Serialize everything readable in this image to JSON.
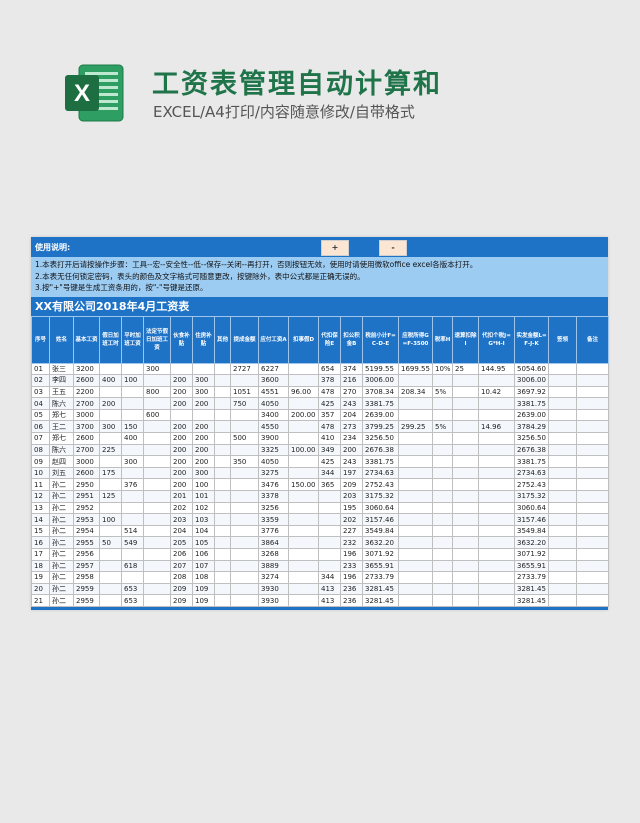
{
  "header": {
    "logo_icon": "excel-icon",
    "logo_letter": "X",
    "title": "工资表管理自动计算和",
    "subtitle": "EXCEL/A4打印/内容随意修改/自带格式"
  },
  "instructions": {
    "label": "使用说明:",
    "btn_plus": "+",
    "btn_minus": "-",
    "lines": [
      "1.本表打开后请按操作步骤：工具--宏--安全性--低--保存--关闭--再打开，否则按钮无效，使用时请使用微软office excel各版本打开。",
      "2.本表无任何锁定密码，表头的颜色及文字格式可随意更改，按键除外，表中公式都是正确无误的。",
      "3.按\"+\"号键是生成工资条用的，按\"-\"号键是还原。"
    ]
  },
  "company_title": "XX有限公司2018年4月工资表",
  "table": {
    "headers": [
      "序号",
      "姓名",
      "基本工资",
      "假日加班工时",
      "平时加班工资",
      "法定节假日加班工资",
      "伙食补贴",
      "住房补贴",
      "其他",
      "提成金额",
      "应付工资A",
      "扣事假D",
      "代扣保险E",
      "扣公积金B",
      "税前小计F=C-D-E",
      "应税所得G=F-3500",
      "税率H",
      "速算扣除I",
      "代扣个税J=G*H-I",
      "实发金额L=F-J-K",
      "签领",
      "备注"
    ],
    "rows": [
      [
        "01",
        "张三",
        "3200",
        "",
        "",
        "300",
        "",
        "",
        "",
        "2727",
        "6227",
        "",
        "654",
        "374",
        "5199.55",
        "1699.55",
        "10%",
        "25",
        "144.95",
        "5054.60",
        "",
        ""
      ],
      [
        "02",
        "李四",
        "2600",
        "400",
        "100",
        "",
        "200",
        "300",
        "",
        "",
        "3600",
        "",
        "378",
        "216",
        "3006.00",
        "",
        "",
        "",
        "",
        "3006.00",
        "",
        ""
      ],
      [
        "03",
        "王五",
        "2200",
        "",
        "",
        "800",
        "200",
        "300",
        "",
        "1051",
        "4551",
        "96.00",
        "478",
        "270",
        "3708.34",
        "208.34",
        "5%",
        "",
        "10.42",
        "3697.92",
        "",
        ""
      ],
      [
        "04",
        "陈六",
        "2700",
        "200",
        "",
        "",
        "200",
        "200",
        "",
        "750",
        "4050",
        "",
        "425",
        "243",
        "3381.75",
        "",
        "",
        "",
        "",
        "3381.75",
        "",
        ""
      ],
      [
        "05",
        "郑七",
        "3000",
        "",
        "",
        "600",
        "",
        "",
        "",
        "",
        "3400",
        "200.00",
        "357",
        "204",
        "2639.00",
        "",
        "",
        "",
        "",
        "2639.00",
        "",
        ""
      ],
      [
        "06",
        "王二",
        "3700",
        "300",
        "150",
        "",
        "200",
        "200",
        "",
        "",
        "4550",
        "",
        "478",
        "273",
        "3799.25",
        "299.25",
        "5%",
        "",
        "14.96",
        "3784.29",
        "",
        ""
      ],
      [
        "07",
        "郑七",
        "2600",
        "",
        "400",
        "",
        "200",
        "200",
        "",
        "500",
        "3900",
        "",
        "410",
        "234",
        "3256.50",
        "",
        "",
        "",
        "",
        "3256.50",
        "",
        ""
      ],
      [
        "08",
        "陈六",
        "2700",
        "225",
        "",
        "",
        "200",
        "200",
        "",
        "",
        "3325",
        "100.00",
        "349",
        "200",
        "2676.38",
        "",
        "",
        "",
        "",
        "2676.38",
        "",
        ""
      ],
      [
        "09",
        "赵四",
        "3000",
        "",
        "300",
        "",
        "200",
        "200",
        "",
        "350",
        "4050",
        "",
        "425",
        "243",
        "3381.75",
        "",
        "",
        "",
        "",
        "3381.75",
        "",
        ""
      ],
      [
        "10",
        "刘五",
        "2600",
        "175",
        "",
        "",
        "200",
        "300",
        "",
        "",
        "3275",
        "",
        "344",
        "197",
        "2734.63",
        "",
        "",
        "",
        "",
        "2734.63",
        "",
        ""
      ],
      [
        "11",
        "孙二",
        "2950",
        "",
        "376",
        "",
        "200",
        "100",
        "",
        "",
        "3476",
        "150.00",
        "365",
        "209",
        "2752.43",
        "",
        "",
        "",
        "",
        "2752.43",
        "",
        ""
      ],
      [
        "12",
        "孙二",
        "2951",
        "125",
        "",
        "",
        "201",
        "101",
        "",
        "",
        "3378",
        "",
        "",
        "203",
        "3175.32",
        "",
        "",
        "",
        "",
        "3175.32",
        "",
        ""
      ],
      [
        "13",
        "孙二",
        "2952",
        "",
        "",
        "",
        "202",
        "102",
        "",
        "",
        "3256",
        "",
        "",
        "195",
        "3060.64",
        "",
        "",
        "",
        "",
        "3060.64",
        "",
        ""
      ],
      [
        "14",
        "孙二",
        "2953",
        "100",
        "",
        "",
        "203",
        "103",
        "",
        "",
        "3359",
        "",
        "",
        "202",
        "3157.46",
        "",
        "",
        "",
        "",
        "3157.46",
        "",
        ""
      ],
      [
        "15",
        "孙二",
        "2954",
        "",
        "514",
        "",
        "204",
        "104",
        "",
        "",
        "3776",
        "",
        "",
        "227",
        "3549.84",
        "",
        "",
        "",
        "",
        "3549.84",
        "",
        ""
      ],
      [
        "16",
        "孙二",
        "2955",
        "50",
        "549",
        "",
        "205",
        "105",
        "",
        "",
        "3864",
        "",
        "",
        "232",
        "3632.20",
        "",
        "",
        "",
        "",
        "3632.20",
        "",
        ""
      ],
      [
        "17",
        "孙二",
        "2956",
        "",
        "",
        "",
        "206",
        "106",
        "",
        "",
        "3268",
        "",
        "",
        "196",
        "3071.92",
        "",
        "",
        "",
        "",
        "3071.92",
        "",
        ""
      ],
      [
        "18",
        "孙二",
        "2957",
        "",
        "618",
        "",
        "207",
        "107",
        "",
        "",
        "3889",
        "",
        "",
        "233",
        "3655.91",
        "",
        "",
        "",
        "",
        "3655.91",
        "",
        ""
      ],
      [
        "19",
        "孙二",
        "2958",
        "",
        "",
        "",
        "208",
        "108",
        "",
        "",
        "3274",
        "",
        "344",
        "196",
        "2733.79",
        "",
        "",
        "",
        "",
        "2733.79",
        "",
        ""
      ],
      [
        "20",
        "孙二",
        "2959",
        "",
        "653",
        "",
        "209",
        "109",
        "",
        "",
        "3930",
        "",
        "413",
        "236",
        "3281.45",
        "",
        "",
        "",
        "",
        "3281.45",
        "",
        ""
      ],
      [
        "21",
        "孙二",
        "2959",
        "",
        "653",
        "",
        "209",
        "109",
        "",
        "",
        "3930",
        "",
        "413",
        "236",
        "3281.45",
        "",
        "",
        "",
        "",
        "3281.45",
        "",
        ""
      ]
    ]
  }
}
